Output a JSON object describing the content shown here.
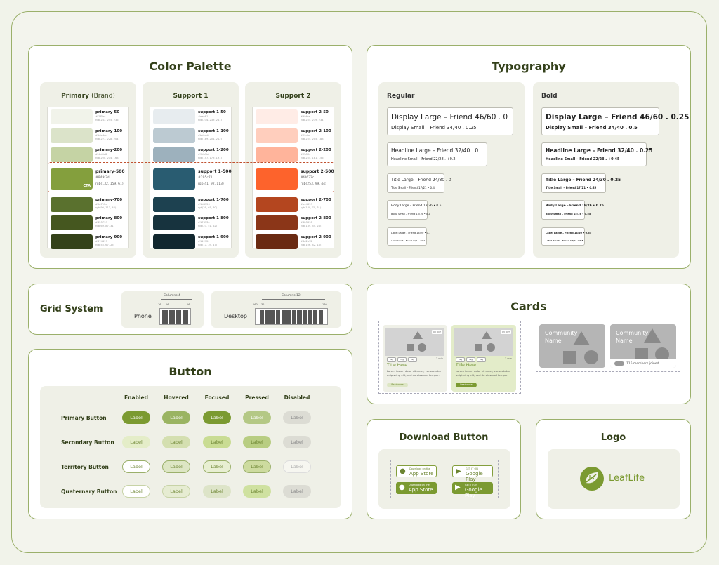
{
  "colors": {
    "accent": "#7b9a31",
    "border": "#9bb06b",
    "title": "#33401a",
    "highlight": "#c0502e"
  },
  "color_palette": {
    "title": "Color Palette",
    "columns": [
      {
        "head": "Primary",
        "head_sub": "(Brand)",
        "swatches": [
          {
            "name": "primary-50",
            "hex": "#f1f5ec",
            "rgb": "rgb(243, 245, 236)",
            "color": "#f1f3ea"
          },
          {
            "name": "primary-100",
            "hex": "#dde4cc",
            "rgb": "rgb(221, 228, 204)",
            "color": "#dbe3c9"
          },
          {
            "name": "primary-200",
            "hex": "#c8d6a8",
            "rgb": "rgb(200, 214, 168)",
            "color": "#c5d3a4"
          },
          {
            "name": "primary-500",
            "hex": "#849f3d",
            "rgb": "rgb(132, 159, 61)",
            "color": "#849f3d",
            "cta": "CTA"
          },
          {
            "name": "primary-700",
            "hex": "#5a712e",
            "rgb": "rgb(90, 113, 46)",
            "color": "#5a712e"
          },
          {
            "name": "primary-800",
            "hex": "#45571f",
            "rgb": "rgb(69, 87, 31)",
            "color": "#45571f"
          },
          {
            "name": "primary-900",
            "hex": "#374419",
            "rgb": "rgb(55, 67, 25)",
            "color": "#344219"
          }
        ]
      },
      {
        "head": "Support 1",
        "head_sub": "",
        "swatches": [
          {
            "name": "support 1-50",
            "hex": "#eaeff1",
            "rgb": "rgb(234, 239, 241)",
            "color": "#e7ecef"
          },
          {
            "name": "support 1-100",
            "hex": "#bdccd4",
            "rgb": "rgb(189, 204, 212)",
            "color": "#bccad2"
          },
          {
            "name": "support 1-200",
            "hex": "#9db3bf",
            "rgb": "rgb(157, 179, 191)",
            "color": "#9db1bd"
          },
          {
            "name": "support 1-500",
            "hex": "#295c71",
            "rgb": "rgb(41, 92, 113)",
            "color": "#295c71"
          },
          {
            "name": "support 1-700",
            "hex": "#1d4150",
            "rgb": "rgb(29, 65, 80)",
            "color": "#1d4150"
          },
          {
            "name": "support 1-800",
            "hex": "#17333e",
            "rgb": "rgb(23, 51, 62)",
            "color": "#17333e"
          },
          {
            "name": "support 1-900",
            "hex": "#11272f",
            "rgb": "rgb(17, 39, 47)",
            "color": "#11272f"
          }
        ]
      },
      {
        "head": "Support 2",
        "head_sub": "",
        "swatches": [
          {
            "name": "support 2-50",
            "hex": "#ffefea",
            "rgb": "rgb(255, 239, 234)",
            "color": "#ffece6"
          },
          {
            "name": "support 2-100",
            "hex": "#ffcdbc",
            "rgb": "rgb(255, 205, 188)",
            "color": "#ffcebd"
          },
          {
            "name": "support 2-200",
            "hex": "#ffb59c",
            "rgb": "rgb(255, 181, 156)",
            "color": "#ffb49b"
          },
          {
            "name": "support 2-500",
            "hex": "#fd632c",
            "rgb": "rgb(253, 99, 44)",
            "color": "#fd632c"
          },
          {
            "name": "support 2-700",
            "hex": "#b4461f",
            "rgb": "rgb(180, 70, 31)",
            "color": "#b4461f"
          },
          {
            "name": "support 2-800",
            "hex": "#8b3618",
            "rgb": "rgb(139, 54, 24)",
            "color": "#8b3618"
          },
          {
            "name": "support 2-900",
            "hex": "#6a2a12",
            "rgb": "rgb(106, 42, 18)",
            "color": "#6a2a12"
          }
        ]
      }
    ]
  },
  "typography": {
    "title": "Typography",
    "columns": [
      {
        "label": "Regular",
        "weight": "normal",
        "blocks": [
          [
            "Display Large – Friend 46/60 . 0",
            "Display Small – Friend 34/40 . 0.25"
          ],
          [
            "Headline Large – Friend 32/40 . 0",
            "Headline Small – Friend 22/28 . +0.2"
          ],
          [
            "Title Large – Friend 24/30 . 0",
            "Title Small – Friend 17/21 • 0.4"
          ],
          [
            "Body Large – Friend 18/26 • 0.5",
            "Body Small – Friend 15/16 • 0.2"
          ],
          [
            "Label Large – Friend 14/20 • 0.1",
            "Label Small – Friend 12/11 • 0.7"
          ]
        ]
      },
      {
        "label": "Bold",
        "weight": "bold",
        "blocks": [
          [
            "Display Large – Friend 46/60 . 0.25",
            "Display Small – Friend 34/40 . 0.5"
          ],
          [
            "Headline Large – Friend 32/40 . 0.25",
            "Headline Small – Friend 22/28 . +0.45"
          ],
          [
            "Title Large – Friend 24/30 . 0.25",
            "Title Small – Friend 17/21 • 0.65"
          ],
          [
            "Body Large – Friend 18/26 • 0.75",
            "Body Small – Friend 15/16 • 0.55"
          ],
          [
            "Label Large – Friend 14/20 • 0.35",
            "Label Small – Friend 12/11 • 0.8"
          ]
        ]
      }
    ]
  },
  "grid_system": {
    "title": "Grid System",
    "phone": {
      "label": "Phone",
      "columns_label": "Columns 4",
      "m1": "16",
      "m2": "16",
      "m3": "16",
      "columns": 4
    },
    "desktop": {
      "label": "Desktop",
      "columns_label": "Columns 12",
      "m1": "160",
      "m2": "32",
      "m3": "160",
      "columns": 12
    }
  },
  "buttons": {
    "title": "Button",
    "states": [
      "Enabled",
      "Hovered",
      "Focused",
      "Pressed",
      "Disabled"
    ],
    "rows": [
      {
        "name": "Primary Button",
        "label": "Label"
      },
      {
        "name": "Secondary Button",
        "label": "Label"
      },
      {
        "name": "Territory Button",
        "label": "Label"
      },
      {
        "name": "Quaternary Button",
        "label": "Label"
      }
    ]
  },
  "cards": {
    "title": "Cards",
    "product": {
      "title": "Title Here",
      "body": "Lorem ipsum dolor sit amet, consectetur adipiscing elit, sed do eiusmod tempor.",
      "button": "Read more",
      "tag": "Tag",
      "badge": "03 OCT",
      "meta": "3 min"
    },
    "community": {
      "title": "Community Name",
      "members": "115 members joined"
    }
  },
  "download": {
    "title": "Download Button",
    "app_store_top": "Download on the",
    "app_store": "App Store",
    "google_top": "GET IT ON",
    "google": "Google Play"
  },
  "logo": {
    "title": "Logo",
    "brand": "LeafLife"
  }
}
